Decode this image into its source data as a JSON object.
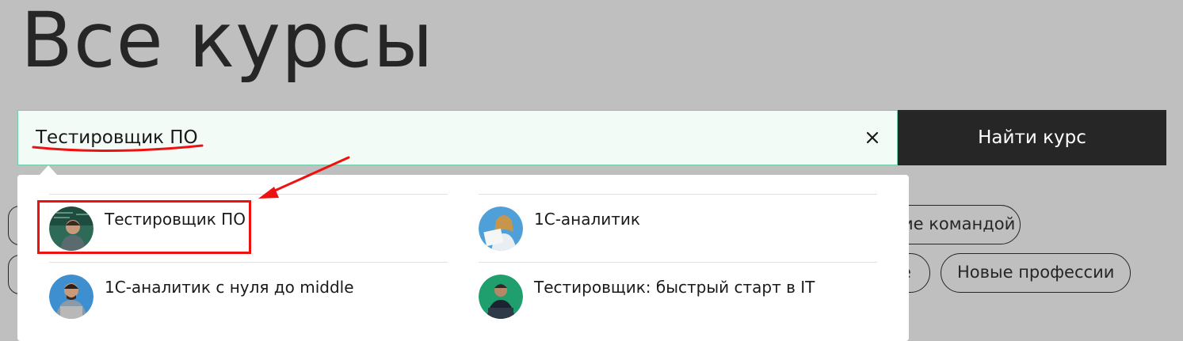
{
  "page": {
    "title": "Все курсы"
  },
  "search": {
    "value": "Тестировщик ПО",
    "button_label": "Найти курс"
  },
  "results": [
    {
      "label": "Тестировщик ПО",
      "avatar": "person-at-whiteboard-avatar"
    },
    {
      "label": "1С-аналитик",
      "avatar": "woman-with-papers-avatar"
    },
    {
      "label": "1С-аналитик с нуля до middle",
      "avatar": "man-with-laptop-avatar"
    },
    {
      "label": "Тестировщик: быстрый старт в IT",
      "avatar": "man-on-green-avatar"
    }
  ],
  "tags": {
    "teamwork": "ие командой",
    "partial": "е",
    "new_professions": "Новые профессии"
  },
  "colors": {
    "background": "#bfbfbf",
    "button": "#262626",
    "search_border": "#6fd0a7",
    "annotation": "#ee1111"
  }
}
